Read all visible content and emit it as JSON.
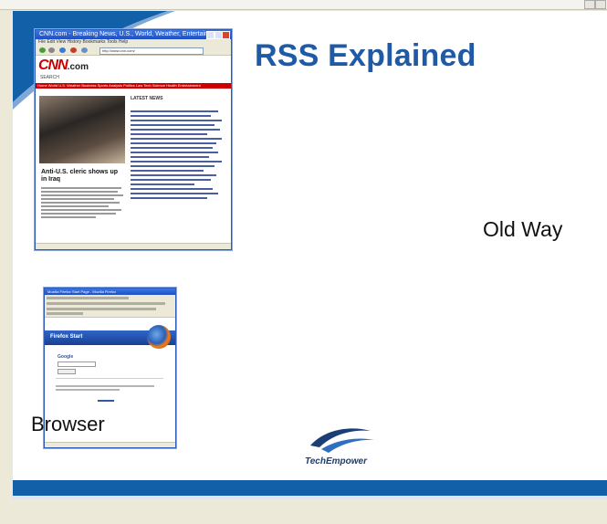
{
  "slide": {
    "title": "RSS Explained",
    "old_way_label": "Old Way",
    "browser_label": "Browser",
    "logo_text": "TechEmpower",
    "colors": {
      "title": "#1f5aa6",
      "band": "#1160a8",
      "swoosh": "#1160a8"
    }
  },
  "cnn_window": {
    "title": "CNN.com - Breaking News, U.S., World, Weather, Entertain...",
    "menu": "File  Edit  View  History  Bookmarks  Tools  Help",
    "url": "http://www.cnn.com/",
    "logo": "CNN",
    "logo_suffix": ".com",
    "search_label": "SEARCH",
    "nav": "Home  World  U.S.  Weather  Business  Sports  Analysis  Politics  Law  Tech  Science  Health  Entertainment",
    "headline": "Anti-U.S. cleric shows up in Iraq",
    "latest_news_label": "LATEST NEWS"
  },
  "firefox_window": {
    "title": "Mozilla Firefox Start Page - Mozilla Firefox",
    "start_label": "Firefox Start",
    "google_label": "Google"
  }
}
